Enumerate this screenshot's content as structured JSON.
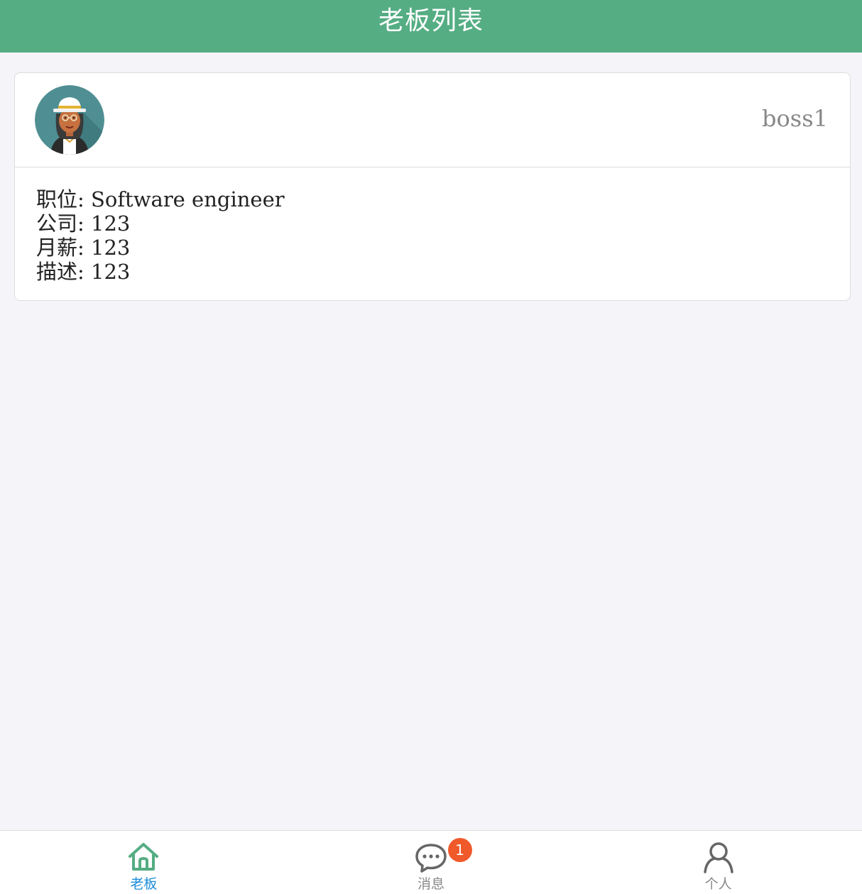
{
  "navbar": {
    "title": "老板列表"
  },
  "boss_card": {
    "avatar_icon": "avatar-woman-hat-icon",
    "name": "boss1",
    "lines": [
      "职位: Software engineer",
      "公司: 123",
      "月薪: 123",
      "描述: 123"
    ]
  },
  "tabbar": {
    "tabs": [
      {
        "label": "老板",
        "icon": "home-icon",
        "active": true
      },
      {
        "label": "消息",
        "icon": "chat-bubble-icon",
        "badge": "1"
      },
      {
        "label": "个人",
        "icon": "user-icon"
      }
    ]
  },
  "colors": {
    "navbar_bg": "#55ad83",
    "active_tab": "#1a8cdc",
    "badge": "#f0592a"
  }
}
